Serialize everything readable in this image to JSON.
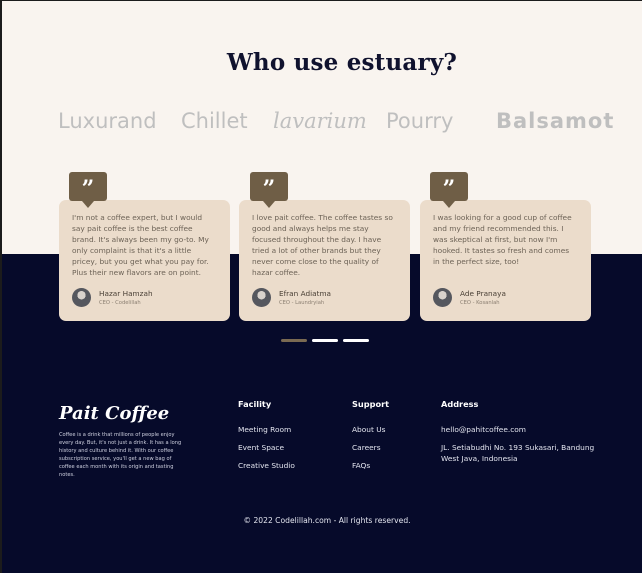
{
  "section": {
    "title": "Who use estuary?"
  },
  "brands": [
    "Luxurand",
    "Chillet",
    "lavarium",
    "Pourry",
    "Balsamot"
  ],
  "testimonials": [
    {
      "quote": "I'm not a coffee expert, but I would say pait coffee is the best coffee brand. It's always been my go-to. My only complaint is that it's a little pricey, but you get what you pay for. Plus their new flavors are on point.",
      "name": "Hazar Hamzah",
      "role": "CEO - Codelillah"
    },
    {
      "quote": "I love pait coffee. The coffee tastes so good and always helps me stay focused throughout the day. I have tried a lot of other brands but they never come close to the quality of hazar coffee.",
      "name": "Efran Adiatma",
      "role": "CEO - Laundryiah"
    },
    {
      "quote": "I was looking for a good cup of coffee and my friend recommended this. I was skeptical at first, but now I'm hooked. It tastes so fresh and comes in the perfect size, too!",
      "name": "Ade Pranaya",
      "role": "CEO - Kosanlah"
    }
  ],
  "quote_mark": "”",
  "slider": {
    "count": 3,
    "active_index": 0
  },
  "footer": {
    "logo": "Pait Coffee",
    "description": "Coffee is a drink that millions of people enjoy every day. But, it's not just a drink. It has a long history and culture behind it. With our coffee subscription service, you'll get a new bag of coffee each month with its origin and tasting notes.",
    "facility": {
      "heading": "Facility",
      "links": [
        "Meeting Room",
        "Event Space",
        "Creative Studio"
      ]
    },
    "support": {
      "heading": "Support",
      "links": [
        "About Us",
        "Careers",
        "FAQs"
      ]
    },
    "address": {
      "heading": "Address",
      "email": "hello@pahitcoffee.com",
      "street": "JL. Setiabudhi No. 193 Sukasari, Bandung",
      "region": "West Java, Indonesia"
    },
    "copyright": "© 2022 Codelillah.com - All rights reserved."
  },
  "colors": {
    "light_background": "#f9f4ef",
    "dark_background": "#060a2a",
    "card_background": "#ebdccb",
    "accent_brown": "#6f5e46",
    "brand_gray": "#bfbfbf"
  }
}
